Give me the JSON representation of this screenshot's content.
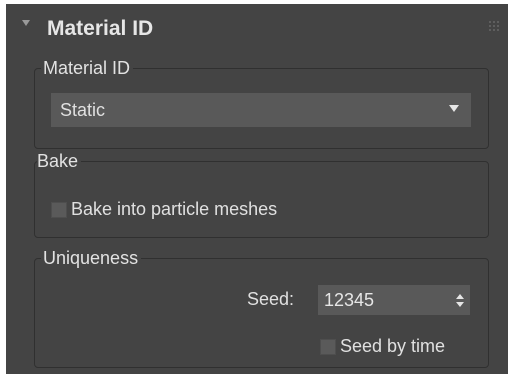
{
  "rollout": {
    "title": "Material ID",
    "collapse_icon": "triangle-down-icon",
    "grip_icon": "drag-grip-icon",
    "colors": {
      "panel_background": "#444444",
      "field_background": "#595959",
      "group_border": "#303030",
      "text": "#e0e0e0"
    }
  },
  "material_group": {
    "label": "Material ID",
    "dropdown": {
      "selected": "Static",
      "arrow_icon": "triangle-down-icon"
    }
  },
  "bake_group": {
    "label": "Bake",
    "checkbox": {
      "label": "Bake into particle meshes",
      "checked": false
    }
  },
  "uniqueness_group": {
    "label": "Uniqueness",
    "seed": {
      "label": "Seed:",
      "value": "12345",
      "spinner_icon": "spinner-arrows-icon"
    },
    "seed_by_time": {
      "label": "Seed by time",
      "checked": false
    }
  }
}
